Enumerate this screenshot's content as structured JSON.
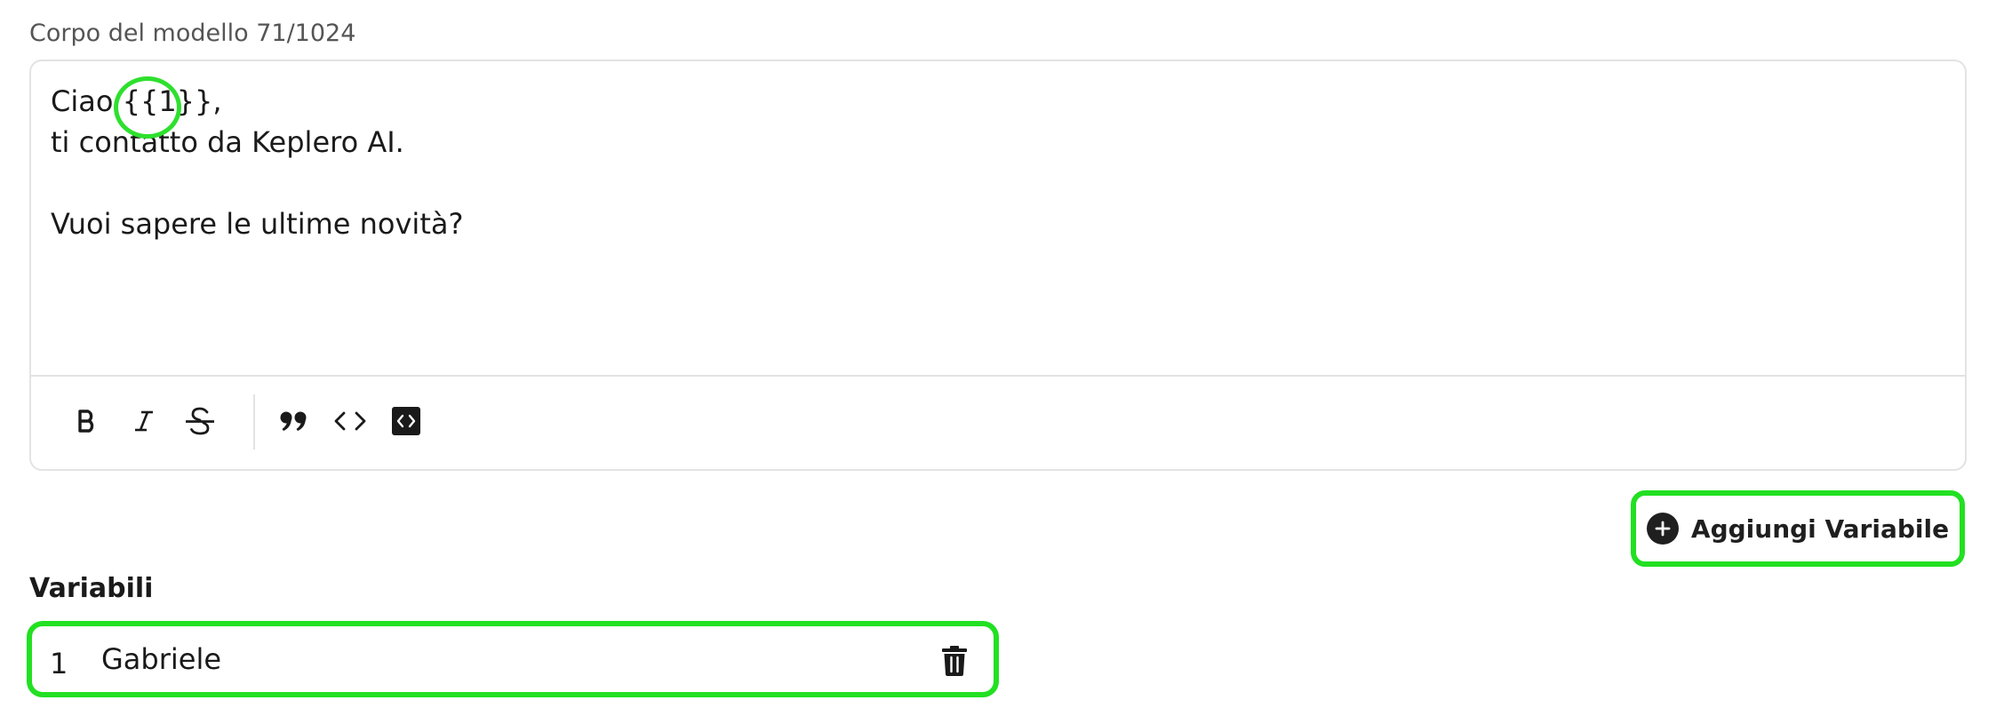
{
  "field": {
    "label": "Corpo del modello 71/1024"
  },
  "editor": {
    "line1_prefix": "Ciao ",
    "variable_token": "{{1}}",
    "line1_suffix": ",",
    "line2": "ti contatto da Keplero AI.",
    "line3": "",
    "line4": "Vuoi sapere le ultime novità?",
    "highlight_color": "#2ee02e"
  },
  "toolbar": {
    "buttons": [
      {
        "name": "bold",
        "icon": "bold-icon"
      },
      {
        "name": "italic",
        "icon": "italic-icon"
      },
      {
        "name": "strikethrough",
        "icon": "strikethrough-icon"
      },
      {
        "name": "quote",
        "icon": "quote-icon"
      },
      {
        "name": "inline-code",
        "icon": "code-icon"
      },
      {
        "name": "code-block",
        "icon": "code-block-icon"
      }
    ]
  },
  "actions": {
    "add_variable_label": "Aggiungi Variabile"
  },
  "variables": {
    "title": "Variabili",
    "items": [
      {
        "index": "1",
        "value": "Gabriele"
      }
    ]
  }
}
